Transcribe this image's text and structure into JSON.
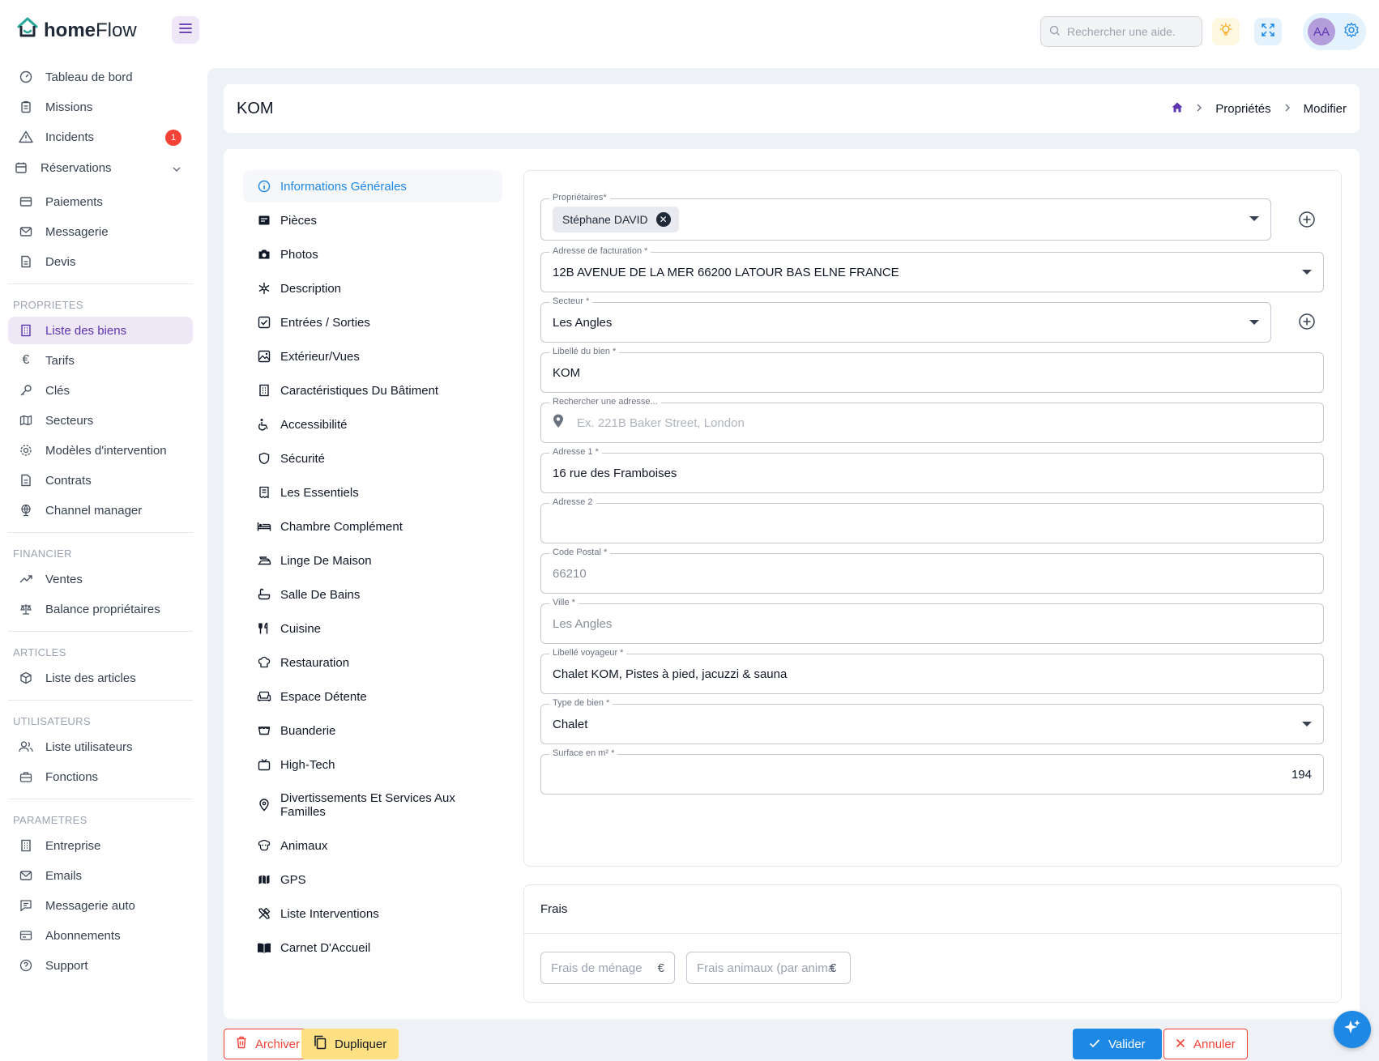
{
  "app": {
    "logo_bold": "home",
    "logo_light": "Flow",
    "search_placeholder": "Rechercher une aide.",
    "avatar_initials": "AA"
  },
  "colors": {
    "primary": "#1e88e5",
    "accent_purple": "#5e35b1",
    "danger": "#f44336",
    "warning": "#ffe082",
    "content_bg": "#eef2f6"
  },
  "sidebar": {
    "top_items": [
      {
        "label": "Tableau de bord",
        "icon": "dashboard-icon"
      },
      {
        "label": "Missions",
        "icon": "clipboard-icon"
      },
      {
        "label": "Incidents",
        "icon": "warning-icon",
        "badge": "1"
      },
      {
        "label": "Réservations",
        "icon": "calendar-icon"
      },
      {
        "label": "Paiements",
        "icon": "credit-card-icon"
      },
      {
        "label": "Messagerie",
        "icon": "mail-icon"
      },
      {
        "label": "Devis",
        "icon": "document-icon"
      }
    ],
    "sections": [
      {
        "title": "PROPRIETES",
        "items": [
          "Liste des biens",
          "Tarifs",
          "Clés",
          "Secteurs",
          "Modèles d'intervention",
          "Contrats",
          "Channel manager"
        ]
      },
      {
        "title": "FINANCIER",
        "items": [
          "Ventes",
          "Balance propriétaires"
        ]
      },
      {
        "title": "ARTICLES",
        "items": [
          "Liste des articles"
        ]
      },
      {
        "title": "UTILISATEURS",
        "items": [
          "Liste utilisateurs",
          "Fonctions"
        ]
      },
      {
        "title": "PARAMETRES",
        "items": [
          "Entreprise",
          "Emails",
          "Messagerie auto",
          "Abonnements",
          "Support"
        ]
      }
    ]
  },
  "header": {
    "title": "KOM",
    "breadcrumb": [
      "Propriétés",
      "Modifier"
    ]
  },
  "section_menu": [
    "Informations Générales",
    "Pièces",
    "Photos",
    "Description",
    "Entrées / Sorties",
    "Extérieur/Vues",
    "Caractéristiques Du Bâtiment",
    "Accessibilité",
    "Sécurité",
    "Les Essentiels",
    "Chambre Complément",
    "Linge De Maison",
    "Salle De Bains",
    "Cuisine",
    "Restauration",
    "Espace Détente",
    "Buanderie",
    "High-Tech",
    "Divertissements Et Services Aux Familles",
    "Animaux",
    "GPS",
    "Liste Interventions",
    "Carnet D'Accueil"
  ],
  "form": {
    "proprietaires": {
      "label": "Propriétaires*",
      "chip": "Stéphane DAVID"
    },
    "adresse_facturation": {
      "label": "Adresse de facturation *",
      "value": "12B AVENUE DE LA MER 66200 LATOUR BAS ELNE FRANCE"
    },
    "secteur": {
      "label": "Secteur *",
      "value": "Les Angles"
    },
    "libelle_bien": {
      "label": "Libellé du bien *",
      "value": "KOM"
    },
    "recherche_adresse": {
      "label": "Rechercher une adresse...",
      "placeholder": "Ex. 221B Baker Street, London"
    },
    "adresse1": {
      "label": "Adresse 1 *",
      "value": "16 rue des Framboises"
    },
    "adresse2": {
      "label": "Adresse 2",
      "value": ""
    },
    "code_postal": {
      "label": "Code Postal *",
      "value": "66210"
    },
    "ville": {
      "label": "Ville *",
      "value": "Les Angles"
    },
    "libelle_voyageur": {
      "label": "Libellé voyageur *",
      "value": "Chalet KOM, Pistes à pied, jacuzzi & sauna"
    },
    "type_bien": {
      "label": "Type de bien *",
      "value": "Chalet"
    },
    "surface": {
      "label": "Surface en m² *",
      "value": "194"
    }
  },
  "frais": {
    "title": "Frais",
    "menage_placeholder": "Frais de ménage",
    "menage_suffix": "€",
    "animaux_placeholder": "Frais animaux (par animal)",
    "animaux_suffix": "€"
  },
  "footer": {
    "archive": "Archiver",
    "duplicate": "Dupliquer",
    "validate": "Valider",
    "cancel": "Annuler"
  }
}
